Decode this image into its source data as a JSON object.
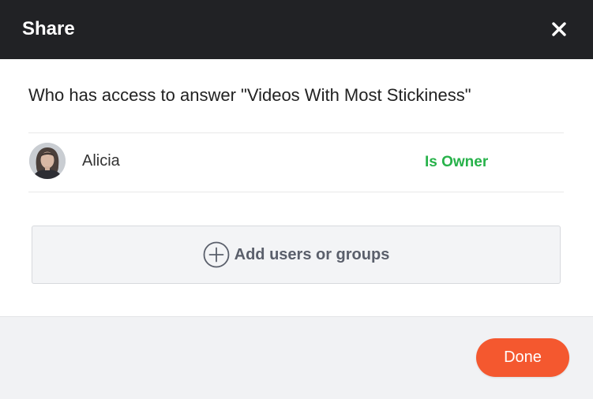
{
  "header": {
    "title": "Share",
    "close_icon": "close-icon"
  },
  "question": "Who has access to answer \"Videos With Most Stickiness\"",
  "users": [
    {
      "name": "Alicia",
      "role": "Is Owner",
      "avatar": "user-avatar"
    }
  ],
  "add_button": {
    "label": "Add users or groups",
    "icon": "plus-circle-icon"
  },
  "footer": {
    "done_label": "Done"
  },
  "colors": {
    "header_bg": "#212225",
    "owner_green": "#27b24a",
    "done_orange": "#f4582f",
    "footer_bg": "#f1f2f4"
  }
}
